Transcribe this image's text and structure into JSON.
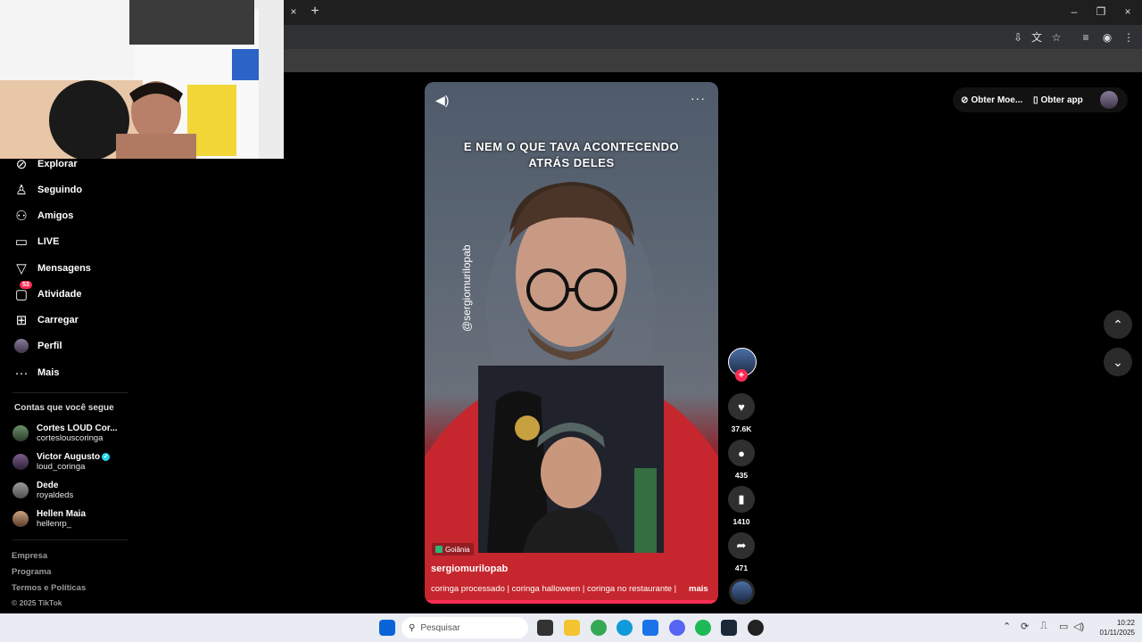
{
  "browser": {
    "tab_close": "×",
    "new_tab": "+",
    "window_controls": [
      "–",
      "❐",
      "×"
    ]
  },
  "sidebar": {
    "items": [
      {
        "label": "Explorar",
        "icon": "compass-icon"
      },
      {
        "label": "Seguindo",
        "icon": "following-icon"
      },
      {
        "label": "Amigos",
        "icon": "friends-icon"
      },
      {
        "label": "LIVE",
        "icon": "live-icon"
      },
      {
        "label": "Mensagens",
        "icon": "messages-icon"
      },
      {
        "label": "Atividade",
        "icon": "activity-icon",
        "badge": "53"
      },
      {
        "label": "Carregar",
        "icon": "upload-icon"
      },
      {
        "label": "Perfil",
        "icon": "profile-icon"
      },
      {
        "label": "Mais",
        "icon": "more-icon"
      }
    ],
    "following_title": "Contas que você segue",
    "following": [
      {
        "name": "Cortes LOUD Cor...",
        "user": "corteslouscoringa",
        "verified": false
      },
      {
        "name": "Victor Augusto",
        "user": "loud_coringa",
        "verified": true
      },
      {
        "name": "Dede",
        "user": "royaldeds",
        "verified": false
      },
      {
        "name": "Hellen Maia",
        "user": "hellenrp_",
        "verified": false
      }
    ],
    "footer": {
      "links": [
        "Empresa",
        "Programa",
        "Termos e Políticas"
      ],
      "copyright": "© 2025 TikTok"
    }
  },
  "video": {
    "caption": "E NEM O QUE TAVA ACONTECENDO ATRÁS DELES",
    "watermark": "@sergiomurilopab",
    "location": "Goiânia",
    "author": "sergiomurilopab",
    "description": "coringa processado | coringa halloween | coringa no restaurante |",
    "more": "mais",
    "progress": 1.0
  },
  "actions": {
    "likes": "37.6K",
    "comments": "435",
    "saves": "1410",
    "shares": "471"
  },
  "header": {
    "coins": "Obter Moe...",
    "get_app": "Obter app"
  },
  "taskbar": {
    "search_placeholder": "Pesquisar",
    "time": "10:22",
    "date": "01/11/2025"
  },
  "colors": {
    "accent": "#fe2c55",
    "verified": "#20d5ec"
  }
}
